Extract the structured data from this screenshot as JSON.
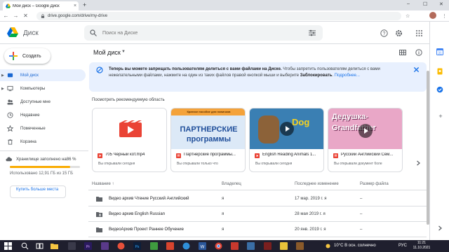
{
  "browser": {
    "tab_title": "Мой диск – Google Диск",
    "tab_close": "×",
    "new_tab": "+",
    "url": "drive.google.com/drive/my-drive",
    "win_min": "–",
    "win_max": "☐",
    "win_close": "✕",
    "back": "←",
    "forward": "→",
    "reload": "✕",
    "star": "☆",
    "menu": "⋮"
  },
  "header": {
    "app_name": "Диск",
    "search_placeholder": "Поиск на Диске"
  },
  "sidebar": {
    "create_label": "Создать",
    "items": [
      {
        "label": "Мой диск",
        "icon": "drive-icon",
        "active": true
      },
      {
        "label": "Компьютеры",
        "icon": "computer-icon"
      },
      {
        "label": "Доступные мне",
        "icon": "shared-icon"
      },
      {
        "label": "Недавние",
        "icon": "clock-icon"
      },
      {
        "label": "Помеченные",
        "icon": "star-icon"
      },
      {
        "label": "Корзина",
        "icon": "trash-icon"
      }
    ],
    "storage_label": "Хранилище заполнено на86 %",
    "storage_fraction": 0.86,
    "storage_used_text": "Использовано 12,91 ГБ из 15 ГБ",
    "buy_label": "Купить больше места"
  },
  "main": {
    "breadcrumb": "Мой диск",
    "banner": {
      "bold": "Теперь вы можете запрещать пользователям делиться с вами файлами на Диске.",
      "text1": " Чтобы запретить пользователям делиться с вами нежелательными файлами, нажмите на один из таких файлов правой кнопкой мыши и выберите ",
      "bold2": "Заблокировать",
      "text2": ". ",
      "link": "Подробнее..."
    },
    "suggested_label": "Посмотреть рекомендуемую область",
    "cards": [
      {
        "name": "705 Черный кот.mp4",
        "sub": "Вы открывали сегодня"
      },
      {
        "name": "Партнерские программы...",
        "sub": "Вы открывали только что",
        "thumb_top": "Краткое пособие для новичков",
        "thumb_title1": "ПАРТНЕРСКИЕ",
        "thumb_title2": "программы"
      },
      {
        "name": "English Reading Animals 1...",
        "sub": "Вы открывали сегодня",
        "thumb_title": "Dog"
      },
      {
        "name": "Русский Английский Сем...",
        "sub": "Вы открывали документ боле",
        "thumb_title1": "Дедушка-",
        "thumb_title2": "Grandfather"
      }
    ],
    "columns": {
      "name": "Название",
      "owner": "Владелец",
      "modified": "Последнее изменение",
      "size": "Размер файла"
    },
    "sort_arrow": "↑",
    "rows": [
      {
        "name": "Видео архив Чтение Русский Английский",
        "owner": "я",
        "modified": "17 мар. 2019 г. я",
        "size": "–",
        "shared": false
      },
      {
        "name": "Видео архив English Russian",
        "owner": "я",
        "modified": "28 мая 2019 г. я",
        "size": "–",
        "shared": true
      },
      {
        "name": "ВидеоАрхив Проект Раннее Обучение",
        "owner": "я",
        "modified": "20 янв. 2019 г. я",
        "size": "–",
        "shared": false
      }
    ]
  },
  "taskbar": {
    "weather": "10°C  В осн. солнечно",
    "lang": "РУС",
    "time": "11:21",
    "date": "11.10.2021"
  },
  "colors": {
    "accent": "#1a73e8",
    "active_bg": "#e8f0fe",
    "storage": "#f9ab00",
    "video_red": "#ea4335"
  }
}
